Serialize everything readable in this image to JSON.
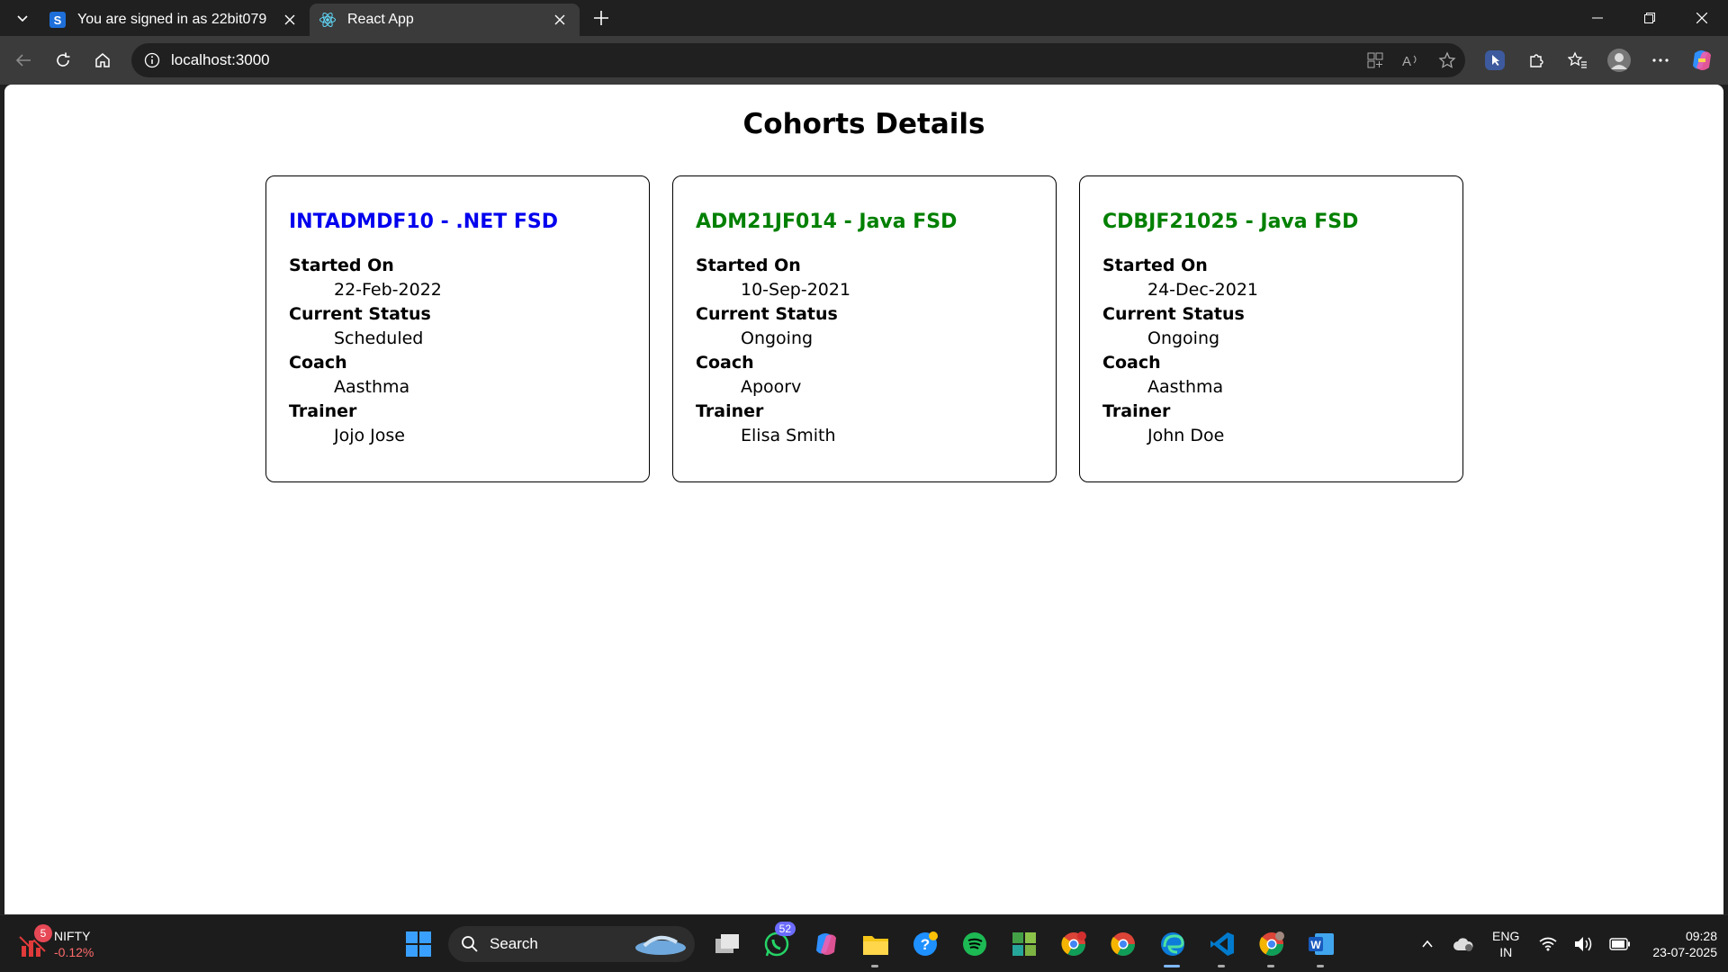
{
  "browser": {
    "tabs": [
      {
        "title": "You are signed in as 22bit079",
        "favicon": "s-logo-icon",
        "active": false
      },
      {
        "title": "React App",
        "favicon": "react-icon",
        "active": true
      }
    ],
    "url": "localhost:3000"
  },
  "page": {
    "title": "Cohorts Details",
    "cohorts": [
      {
        "name": "INTADMDF10 - .NET FSD",
        "name_color": "#0000ee",
        "started_on_label": "Started On",
        "started_on": "22-Feb-2022",
        "status_label": "Current Status",
        "status": "Scheduled",
        "coach_label": "Coach",
        "coach": "Aasthma",
        "trainer_label": "Trainer",
        "trainer": "Jojo Jose"
      },
      {
        "name": "ADM21JF014 - Java FSD",
        "name_color": "#008000",
        "started_on_label": "Started On",
        "started_on": "10-Sep-2021",
        "status_label": "Current Status",
        "status": "Ongoing",
        "coach_label": "Coach",
        "coach": "Apoorv",
        "trainer_label": "Trainer",
        "trainer": "Elisa Smith"
      },
      {
        "name": "CDBJF21025 - Java FSD",
        "name_color": "#008000",
        "started_on_label": "Started On",
        "started_on": "24-Dec-2021",
        "status_label": "Current Status",
        "status": "Ongoing",
        "coach_label": "Coach",
        "coach": "Aasthma",
        "trainer_label": "Trainer",
        "trainer": "John Doe"
      }
    ]
  },
  "taskbar": {
    "ticker": {
      "name": "NIFTY",
      "change": "-0.12%",
      "badge": "5"
    },
    "search_label": "Search",
    "whatsapp_badge": "52",
    "tray": {
      "lang_line1": "ENG",
      "lang_line2": "IN",
      "time": "09:28",
      "date": "23-07-2025"
    }
  }
}
